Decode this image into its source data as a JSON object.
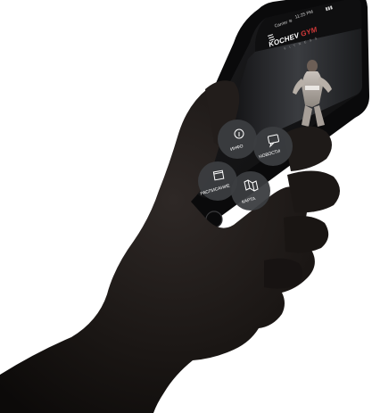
{
  "status_bar": {
    "carrier": "Carrier ≋",
    "time": "11:25 PM",
    "battery": "▮▮▮"
  },
  "app": {
    "brand_main": "KOCHEV",
    "brand_accent": "GYM",
    "brand_sub": "F I T N E S S",
    "accent_color": "#d63a3a"
  },
  "menu": {
    "items": [
      {
        "label": "ИНФО",
        "icon": "info-icon"
      },
      {
        "label": "НОВОСТИ",
        "icon": "chat-bubble-icon"
      },
      {
        "label": "РАСПИСАНИЕ",
        "icon": "calendar-icon"
      },
      {
        "label": "КАРТА",
        "icon": "map-icon"
      }
    ]
  }
}
